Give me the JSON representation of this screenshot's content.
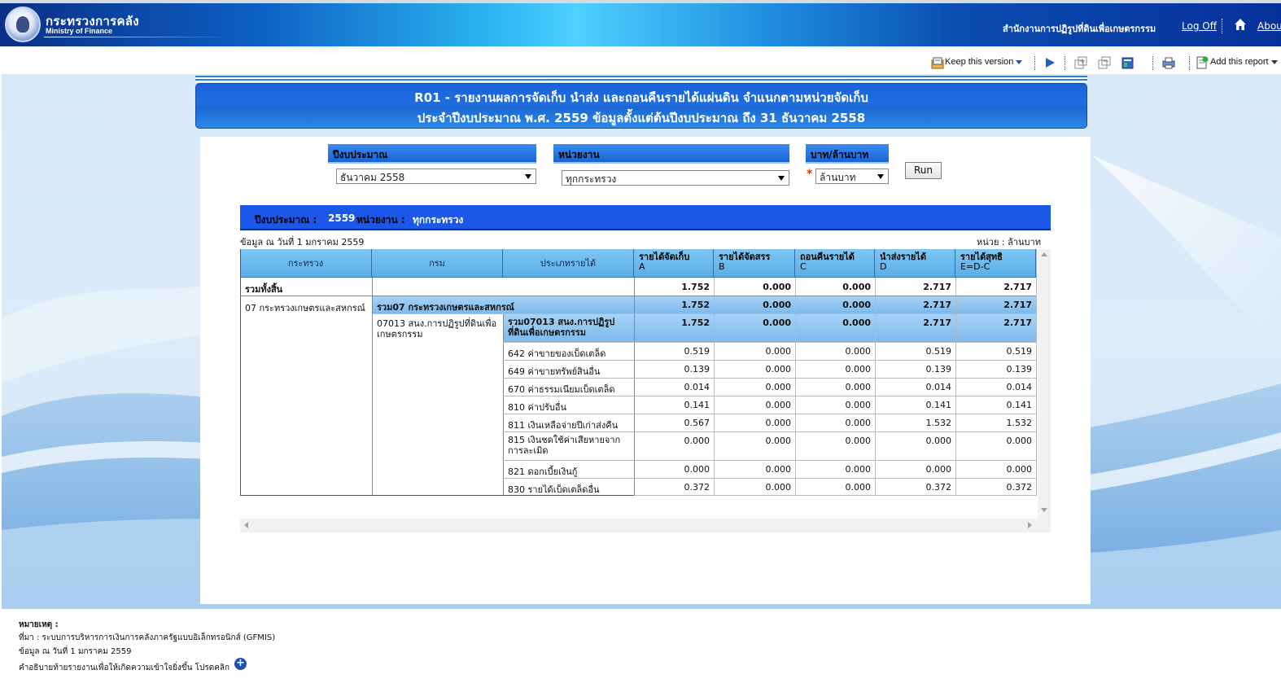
{
  "header": {
    "org_thai": "กระทรวงการคลัง",
    "org_en": "Ministry of Finance",
    "agency": "สำนักงานการปฏิรูปที่ดินเพื่อเกษตรกรรม",
    "logoff": "Log Off",
    "about": "Abou"
  },
  "toolbar": {
    "keep_version": "Keep this version",
    "add_report": "Add this report"
  },
  "report": {
    "title_line1": "R01 - รายงานผลการจัดเก็บ นำส่ง และถอนคืนรายได้แผ่นดิน จำแนกตามหน่วยจัดเก็บ",
    "title_line2": "ประจำปีงบประมาณ พ.ศ. 2559 ข้อมูลตั้งแต่ต้นปีงบประมาณ ถึง  31 ธันวาคม 2558"
  },
  "filters": {
    "budget_year_label": "ปีงบประมาณ",
    "budget_year_value": "ธันวาคม 2558",
    "agency_label": "หน่วยงาน",
    "agency_value": "ทุกกระทรวง",
    "unit_label": "บาท/ล้านบาท",
    "unit_value": "ล้านบาท",
    "required_mark": "*",
    "run": "Run"
  },
  "summary": {
    "year_label": "ปีงบประมาณ :",
    "year_value": "2559",
    "agency_label": "หน่วยงาน :",
    "agency_value": "ทุกกระทรวง",
    "data_as_of": "ข้อมูล ณ วันที่ 1 มกราคม 2559",
    "unit": "หน่วย : ล้านบาท"
  },
  "table": {
    "headers": {
      "ministry": "กระทรวง",
      "department": "กรม",
      "revenue_type": "ประเภทรายได้",
      "collected": "รายได้จัดเก็บ",
      "collected_code": "A",
      "allocated": "รายได้จัดสรร",
      "allocated_code": "B",
      "refund": "ถอนคืนรายได้",
      "refund_code": "C",
      "remitted": "นำส่งรายได้",
      "remitted_code": "D",
      "net": "รายได้สุทธิ",
      "net_code": "E=D-C"
    },
    "grand_total": {
      "label": "รวมทั้งสิ้น",
      "values": [
        "1.752",
        "0.000",
        "0.000",
        "2.717",
        "2.717"
      ]
    },
    "ministry_name": "07 กระทรวงเกษตรและสหกรณ์",
    "ministry_total": {
      "label": "รวม07 กระทรวงเกษตรและสหกรณ์",
      "values": [
        "1.752",
        "0.000",
        "0.000",
        "2.717",
        "2.717"
      ]
    },
    "department_name": "07013 สนง.การปฏิรูปที่ดินเพื่อเกษตรกรรม",
    "department_total": {
      "label": "รวม07013 สนง.การปฏิรูปที่ดินเพื่อเกษตรกรรม",
      "values": [
        "1.752",
        "0.000",
        "0.000",
        "2.717",
        "2.717"
      ]
    },
    "rows": [
      {
        "label": "642 ค่าขายของเบ็ดเตล็ด",
        "values": [
          "0.519",
          "0.000",
          "0.000",
          "0.519",
          "0.519"
        ]
      },
      {
        "label": "649 ค่าขายทรัพย์สินอื่น",
        "values": [
          "0.139",
          "0.000",
          "0.000",
          "0.139",
          "0.139"
        ]
      },
      {
        "label": "670 ค่าธรรมเนียมเบ็ดเตล็ด",
        "values": [
          "0.014",
          "0.000",
          "0.000",
          "0.014",
          "0.014"
        ]
      },
      {
        "label": "810 ค่าปรับอื่น",
        "values": [
          "0.141",
          "0.000",
          "0.000",
          "0.141",
          "0.141"
        ]
      },
      {
        "label": "811 เงินเหลือจ่ายปีเก่าส่งคืน",
        "values": [
          "0.567",
          "0.000",
          "0.000",
          "1.532",
          "1.532"
        ]
      },
      {
        "label": "815 เงินชดใช้ค่าเสียหายจากการละเมิด",
        "values": [
          "0.000",
          "0.000",
          "0.000",
          "0.000",
          "0.000"
        ]
      },
      {
        "label": "821 ดอกเบี้ยเงินกู้",
        "values": [
          "0.000",
          "0.000",
          "0.000",
          "0.000",
          "0.000"
        ]
      },
      {
        "label": "830 รายได้เบ็ดเตล็ดอื่น",
        "values": [
          "0.372",
          "0.000",
          "0.000",
          "0.372",
          "0.372"
        ]
      }
    ]
  },
  "notes": {
    "title": "หมายเหตุ :",
    "source": "ที่มา : ระบบการบริหารการเงินการคลังภาครัฐแบบอิเล็กทรอนิกส์ (GFMIS)",
    "as_of": "ข้อมูล ณ วันที่ 1 มกราคม 2559",
    "explain": "คำอธิบายท้ายรายงานเพื่อให้เกิดความเข้าใจยิ่งขึ้น โปรดคลิก"
  }
}
